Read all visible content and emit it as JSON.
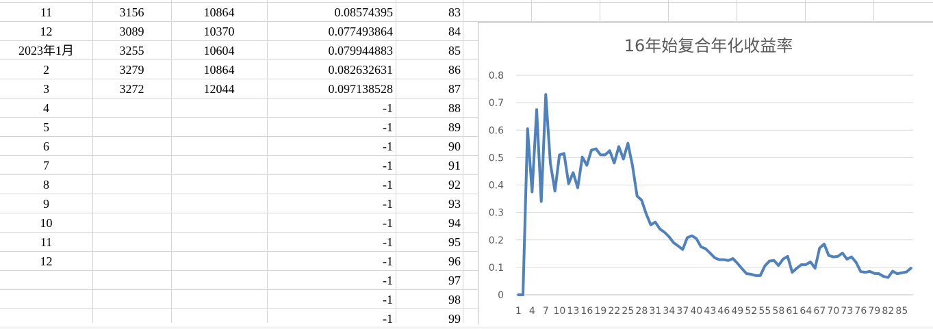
{
  "sheet": {
    "rows": [
      {
        "a": "11",
        "b": "3156",
        "c": "10864",
        "d": "0.08574395",
        "e": "83"
      },
      {
        "a": "12",
        "b": "3089",
        "c": "10370",
        "d": "0.077493864",
        "e": "84"
      },
      {
        "a": "2023年1月",
        "b": "3255",
        "c": "10604",
        "d": "0.079944883",
        "e": "85"
      },
      {
        "a": "2",
        "b": "3279",
        "c": "10864",
        "d": "0.082632631",
        "e": "86"
      },
      {
        "a": "3",
        "b": "3272",
        "c": "12044",
        "d": "0.097138528",
        "e": "87"
      },
      {
        "a": "4",
        "b": "",
        "c": "",
        "d": "-1",
        "e": "88"
      },
      {
        "a": "5",
        "b": "",
        "c": "",
        "d": "-1",
        "e": "89"
      },
      {
        "a": "6",
        "b": "",
        "c": "",
        "d": "-1",
        "e": "90"
      },
      {
        "a": "7",
        "b": "",
        "c": "",
        "d": "-1",
        "e": "91"
      },
      {
        "a": "8",
        "b": "",
        "c": "",
        "d": "-1",
        "e": "92"
      },
      {
        "a": "9",
        "b": "",
        "c": "",
        "d": "-1",
        "e": "93"
      },
      {
        "a": "10",
        "b": "",
        "c": "",
        "d": "-1",
        "e": "94"
      },
      {
        "a": "11",
        "b": "",
        "c": "",
        "d": "-1",
        "e": "95"
      },
      {
        "a": "12",
        "b": "",
        "c": "",
        "d": "-1",
        "e": "96"
      },
      {
        "a": "",
        "b": "",
        "c": "",
        "d": "-1",
        "e": "97"
      },
      {
        "a": "",
        "b": "",
        "c": "",
        "d": "-1",
        "e": "98"
      },
      {
        "a": "",
        "b": "",
        "c": "",
        "d": "-1",
        "e": "99"
      }
    ]
  },
  "chart_data": {
    "type": "line",
    "title": "16年始复合年化收益率",
    "xlabel": "",
    "ylabel": "",
    "ylim": [
      0,
      0.8
    ],
    "yticks": [
      "0",
      "0.1",
      "0.2",
      "0.3",
      "0.4",
      "0.5",
      "0.6",
      "0.7",
      "0.8"
    ],
    "xticks": [
      "1",
      "4",
      "7",
      "10",
      "13",
      "16",
      "19",
      "22",
      "25",
      "28",
      "31",
      "34",
      "37",
      "40",
      "43",
      "46",
      "49",
      "52",
      "55",
      "58",
      "61",
      "64",
      "67",
      "70",
      "73",
      "76",
      "79",
      "82",
      "85"
    ],
    "grid": true,
    "legend": "none",
    "color": "#4f81bd",
    "series": [
      {
        "values": [
          0,
          0,
          0.605,
          0.375,
          0.675,
          0.34,
          0.73,
          0.48,
          0.378,
          0.51,
          0.515,
          0.405,
          0.445,
          0.39,
          0.502,
          0.472,
          0.527,
          0.532,
          0.51,
          0.51,
          0.525,
          0.48,
          0.54,
          0.495,
          0.552,
          0.47,
          0.36,
          0.345,
          0.295,
          0.255,
          0.265,
          0.24,
          0.228,
          0.212,
          0.19,
          0.178,
          0.165,
          0.208,
          0.215,
          0.205,
          0.175,
          0.168,
          0.152,
          0.135,
          0.128,
          0.128,
          0.125,
          0.132,
          0.115,
          0.095,
          0.077,
          0.075,
          0.07,
          0.07,
          0.105,
          0.123,
          0.125,
          0.107,
          0.13,
          0.14,
          0.082,
          0.097,
          0.11,
          0.11,
          0.12,
          0.097,
          0.17,
          0.185,
          0.143,
          0.138,
          0.14,
          0.152,
          0.13,
          0.138,
          0.118,
          0.085,
          0.082,
          0.085,
          0.078,
          0.077,
          0.067,
          0.063,
          0.086,
          0.077,
          0.08,
          0.083,
          0.097
        ]
      }
    ]
  }
}
